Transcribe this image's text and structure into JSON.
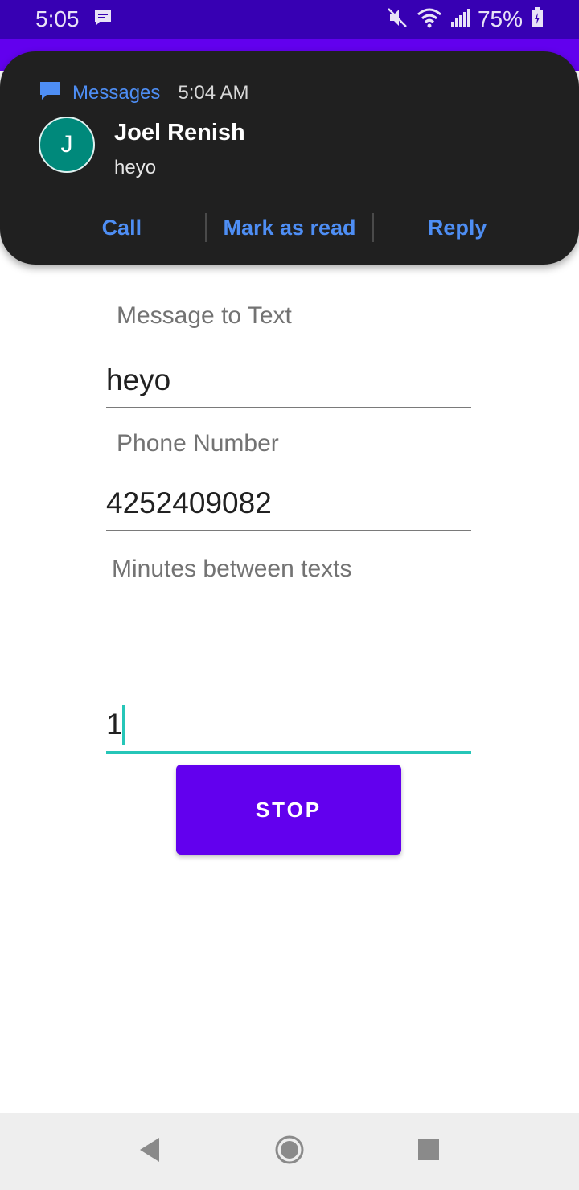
{
  "status_bar": {
    "time": "5:05",
    "battery": "75%",
    "icons": [
      "message-icon",
      "mute-icon",
      "wifi-icon",
      "signal-icon",
      "battery-icon"
    ]
  },
  "notification": {
    "app_name": "Messages",
    "time": "5:04 AM",
    "avatar_letter": "J",
    "sender": "Joel Renish",
    "body": "heyo",
    "actions": [
      "Call",
      "Mark as read",
      "Reply"
    ]
  },
  "form": {
    "message_label": "Message to Text",
    "message_value": "heyo",
    "phone_label": "Phone Number",
    "phone_value": "4252409082",
    "minutes_label": "Minutes between texts",
    "minutes_value": "1",
    "stop_label": "STOP"
  },
  "nav_bar": {
    "icons": [
      "back-icon",
      "home-icon",
      "recents-icon"
    ]
  },
  "colors": {
    "status_bar": "#3700b3",
    "primary": "#6200ee",
    "accent": "#26c6b8",
    "notification_bg": "#202020",
    "notification_link": "#4e8ef4",
    "avatar": "#00897b"
  }
}
